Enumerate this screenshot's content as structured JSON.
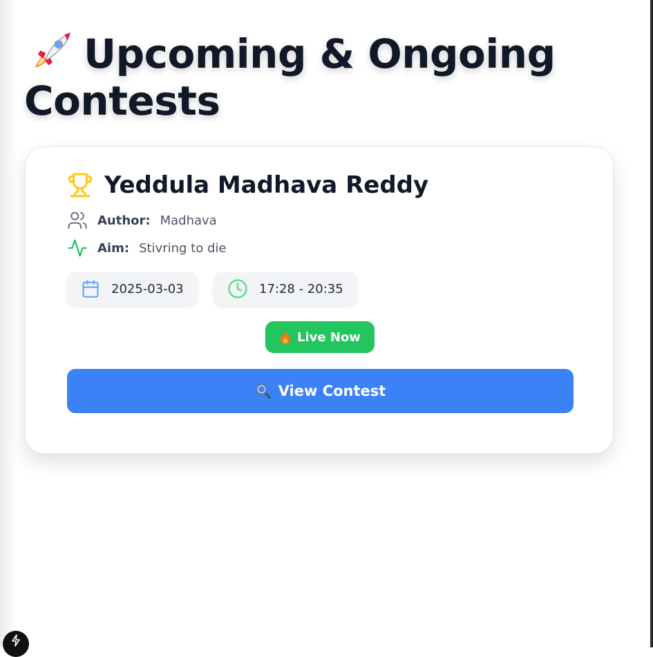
{
  "page": {
    "title": "Upcoming & Ongoing Contests"
  },
  "contest": {
    "title": "Yeddula Madhava Reddy",
    "author_label": "Author:",
    "author_value": "Madhava",
    "aim_label": "Aim:",
    "aim_value": "Stivring to die",
    "date": "2025-03-03",
    "time": "17:28 - 20:35",
    "status": "Live Now",
    "action_label": "View Contest"
  },
  "icons": {
    "title": "rocket-icon",
    "contest": "trophy-icon",
    "author": "users-icon",
    "aim": "activity-pulse-icon",
    "date": "calendar-icon",
    "time": "clock-icon",
    "status": "fire-icon",
    "action": "magnifier-icon",
    "corner": "lightning-icon"
  },
  "colors": {
    "primary": "#3b82f6",
    "live": "#22c55e",
    "trophy": "#facc15",
    "heading": "#111827"
  }
}
